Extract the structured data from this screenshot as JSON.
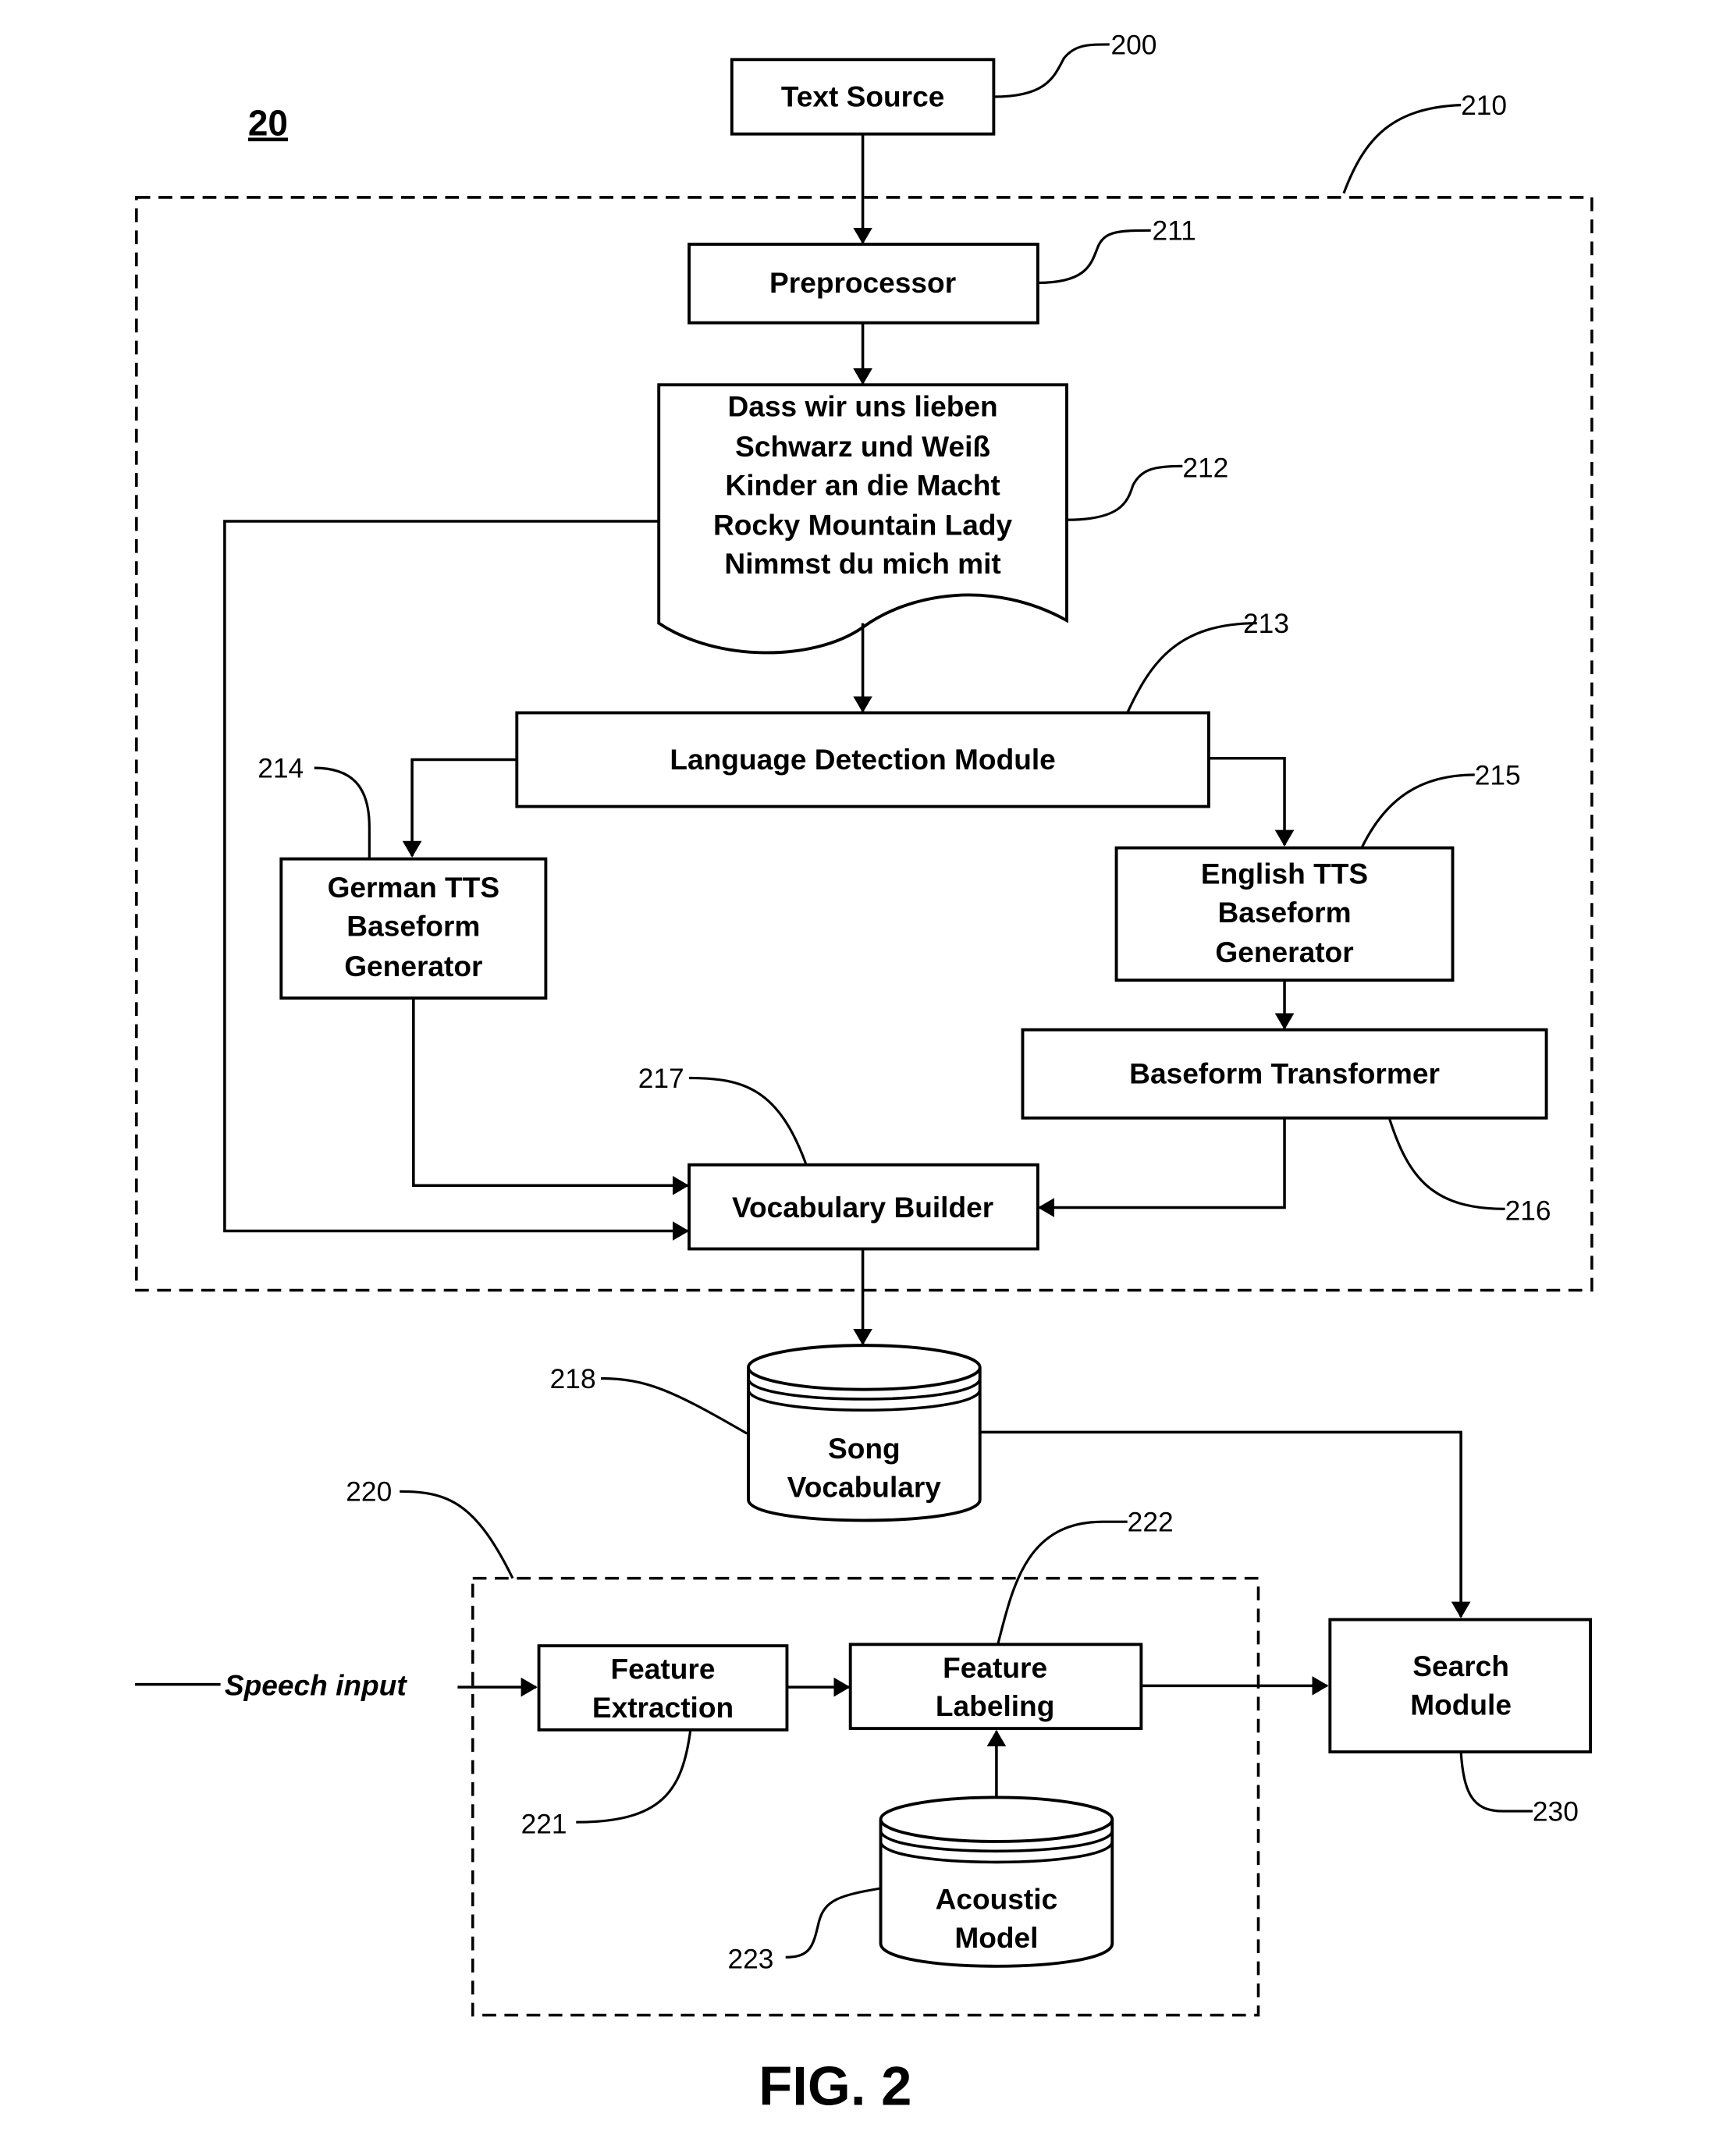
{
  "figure": {
    "number_label": "20",
    "caption": "FIG. 2"
  },
  "nodes": {
    "text_source": {
      "label": "Text Source",
      "ref": "200"
    },
    "group_210": {
      "ref": "210"
    },
    "preprocessor": {
      "label": "Preprocessor",
      "ref": "211"
    },
    "lyrics_document": {
      "ref": "212",
      "lines": [
        "Dass wir uns lieben",
        "Schwarz und Weiß",
        "Kinder an die Macht",
        "Rocky Mountain Lady",
        "Nimmst du mich mit"
      ]
    },
    "language_detection": {
      "label": "Language Detection Module",
      "ref": "213"
    },
    "german_tts": {
      "lines": [
        "German TTS",
        "Baseform",
        "Generator"
      ],
      "ref": "214"
    },
    "english_tts": {
      "lines": [
        "English TTS",
        "Baseform",
        "Generator"
      ],
      "ref": "215"
    },
    "baseform_transformer": {
      "label": "Baseform Transformer",
      "ref": "216"
    },
    "vocabulary_builder": {
      "label": "Vocabulary Builder",
      "ref": "217"
    },
    "song_vocabulary": {
      "lines": [
        "Song",
        "Vocabulary"
      ],
      "ref": "218"
    },
    "group_220": {
      "ref": "220"
    },
    "feature_extraction": {
      "lines": [
        "Feature",
        "Extraction"
      ],
      "ref": "221"
    },
    "feature_labeling": {
      "lines": [
        "Feature",
        "Labeling"
      ],
      "ref": "222"
    },
    "acoustic_model": {
      "lines": [
        "Acoustic",
        "Model"
      ],
      "ref": "223"
    },
    "search_module": {
      "lines": [
        "Search",
        "Module"
      ],
      "ref": "230"
    }
  },
  "inputs": {
    "speech_input": "Speech input"
  },
  "edges": [
    {
      "from": "Text Source",
      "to": "Preprocessor"
    },
    {
      "from": "Preprocessor",
      "to": "Lyrics Document"
    },
    {
      "from": "Lyrics Document",
      "to": "Language Detection Module"
    },
    {
      "from": "Lyrics Document",
      "to": "Vocabulary Builder"
    },
    {
      "from": "Language Detection Module",
      "to": "German TTS Baseform Generator"
    },
    {
      "from": "Language Detection Module",
      "to": "English TTS Baseform Generator"
    },
    {
      "from": "English TTS Baseform Generator",
      "to": "Baseform Transformer"
    },
    {
      "from": "German TTS Baseform Generator",
      "to": "Vocabulary Builder"
    },
    {
      "from": "Baseform Transformer",
      "to": "Vocabulary Builder"
    },
    {
      "from": "Vocabulary Builder",
      "to": "Song Vocabulary"
    },
    {
      "from": "Song Vocabulary",
      "to": "Search Module"
    },
    {
      "from": "Speech input",
      "to": "Feature Extraction"
    },
    {
      "from": "Feature Extraction",
      "to": "Feature Labeling"
    },
    {
      "from": "Acoustic Model",
      "to": "Feature Labeling"
    },
    {
      "from": "Feature Labeling",
      "to": "Search Module"
    }
  ]
}
